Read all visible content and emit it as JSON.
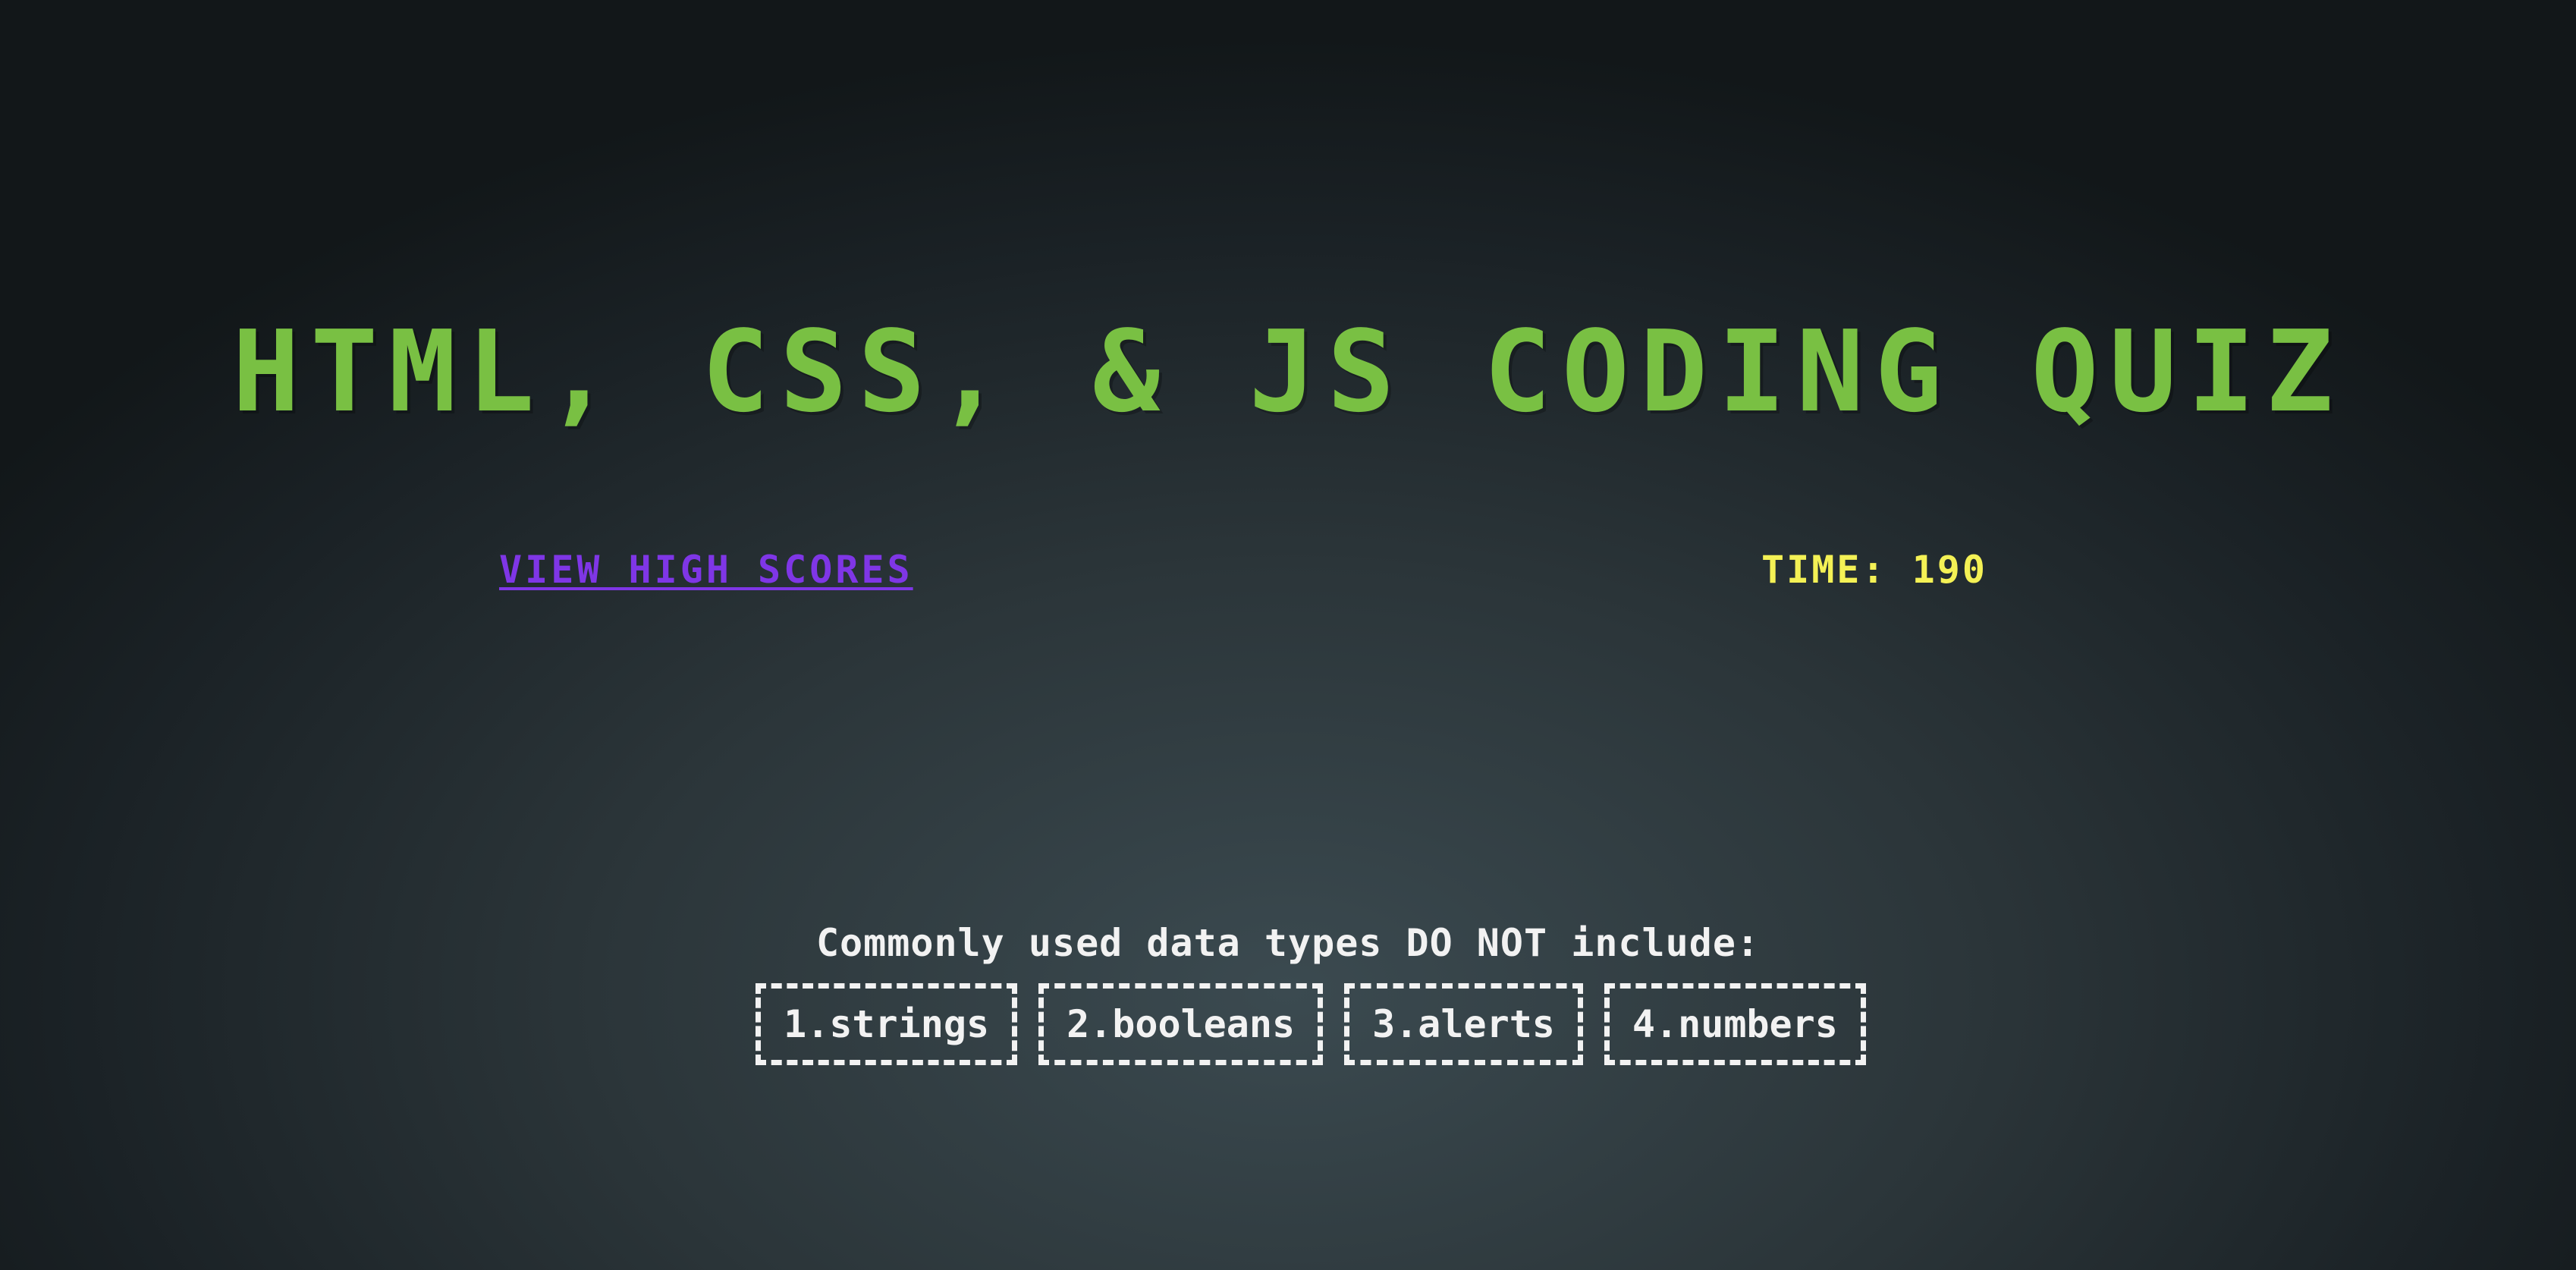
{
  "header": {
    "title": "HTML, CSS, & JS CODING QUIZ",
    "high_scores_link": "VIEW HIGH SCORES",
    "timer_label": "TIME:",
    "timer_value": "190"
  },
  "quiz": {
    "question": "Commonly used data types DO NOT include:",
    "answers": [
      {
        "label": "1.strings"
      },
      {
        "label": "2.booleans"
      },
      {
        "label": "3.alerts"
      },
      {
        "label": "4.numbers"
      }
    ]
  },
  "colors": {
    "title": "#79c043",
    "link": "#7f36e6",
    "timer": "#f4f155",
    "text": "#f2f2f2"
  }
}
